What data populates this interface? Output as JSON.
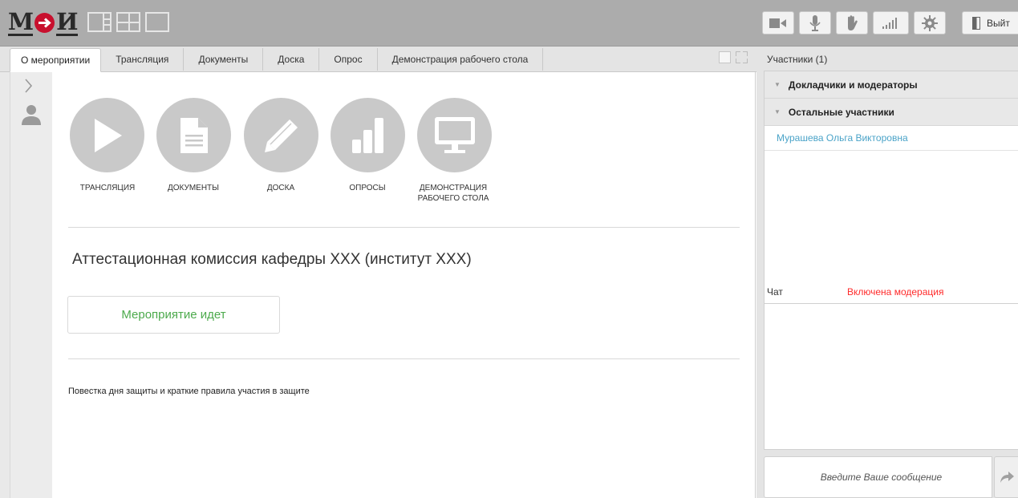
{
  "logo": {
    "letter_left": "М",
    "letter_right": "И"
  },
  "toolbar": {
    "exit_label": "Выйт"
  },
  "tabs": [
    {
      "label": "О мероприятии"
    },
    {
      "label": "Трансляция"
    },
    {
      "label": "Документы"
    },
    {
      "label": "Доска"
    },
    {
      "label": "Опрос"
    },
    {
      "label": "Демонстрация рабочего стола"
    }
  ],
  "modules": [
    {
      "label": "ТРАНСЛЯЦИЯ",
      "icon": "play-icon"
    },
    {
      "label": "ДОКУМЕНТЫ",
      "icon": "document-icon"
    },
    {
      "label": "ДОСКА",
      "icon": "pencil-icon"
    },
    {
      "label": "ОПРОСЫ",
      "icon": "bar-chart-icon"
    },
    {
      "label": "ДЕМОНСТРАЦИЯ РАБОЧЕГО СТОЛА",
      "icon": "monitor-icon"
    }
  ],
  "event": {
    "title": "Аттестационная комиссия кафедры XXX (институт XXX)",
    "status": "Мероприятие идет",
    "agenda": "Повестка дня защиты и краткие правила участия в защите"
  },
  "participants": {
    "title": "Участники (1)",
    "groups": [
      {
        "label": "Докладчики и модераторы"
      },
      {
        "label": "Остальные участники"
      }
    ],
    "users": [
      {
        "name": "Мурашева Ольга Викторовна"
      }
    ]
  },
  "chat": {
    "title": "Чат",
    "moderation": "Включена модерация",
    "placeholder": "Введите Ваше сообщение"
  },
  "colors": {
    "status_green": "#4caa4c",
    "moderation_red": "#ff2b2b",
    "user_link": "#4aa3c8",
    "module_gray": "#c9c9c9"
  }
}
